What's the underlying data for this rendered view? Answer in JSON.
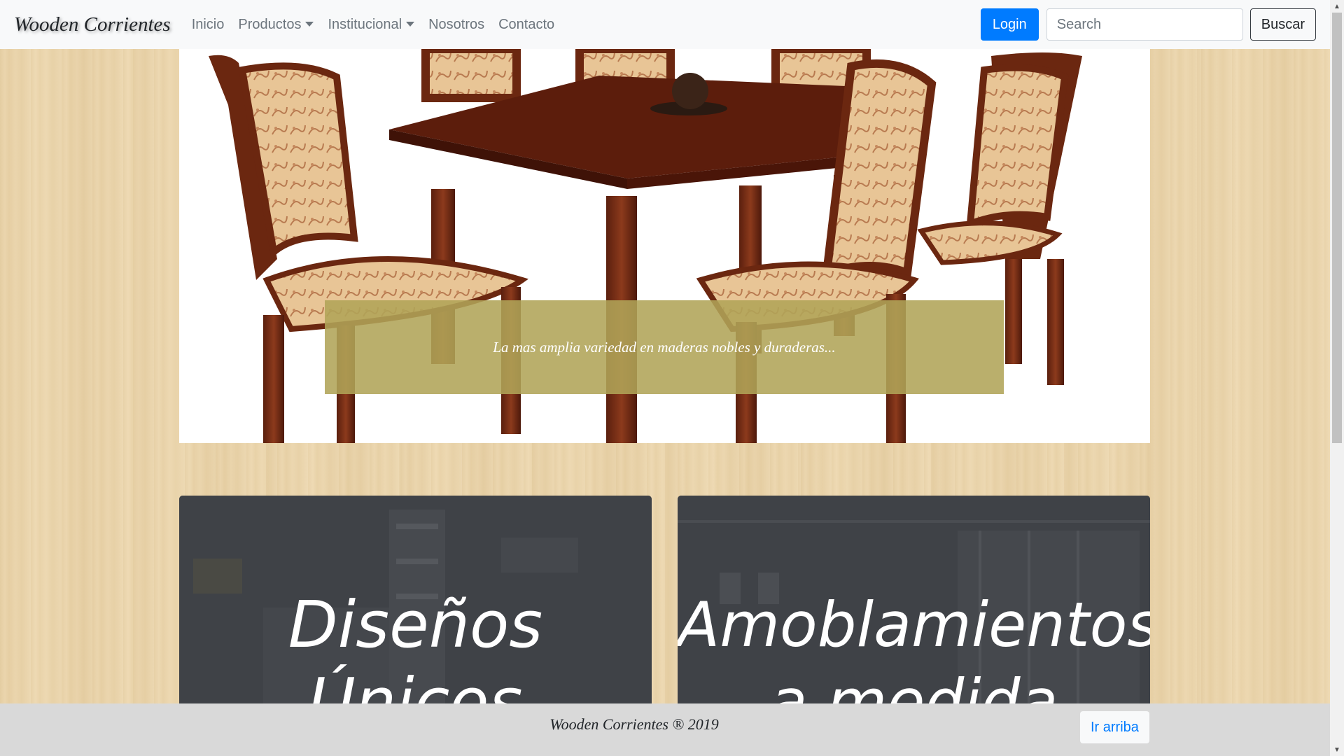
{
  "navbar": {
    "brand": "Wooden Corrientes",
    "items": [
      {
        "label": "Inicio",
        "dropdown": false
      },
      {
        "label": "Productos",
        "dropdown": true
      },
      {
        "label": "Institucional",
        "dropdown": true
      },
      {
        "label": "Nosotros",
        "dropdown": false
      },
      {
        "label": "Contacto",
        "dropdown": false
      }
    ],
    "login_label": "Login",
    "search_placeholder": "Search",
    "search_value": "",
    "search_button_label": "Buscar"
  },
  "hero": {
    "caption": "La mas amplia variedad en maderas nobles y duraderas..."
  },
  "cards": [
    {
      "title": "Diseños Únicos"
    },
    {
      "title": "Amoblamientos a medida"
    }
  ],
  "footer": {
    "text": "Wooden Corrientes ® 2019",
    "top_button_label": "Ir arriba"
  },
  "colors": {
    "primary": "#007bff",
    "navbar_bg": "#f8f9fa",
    "caption_bg": "#b0a458",
    "card_bg": "#3f4247",
    "footer_bg": "#d9d9d9"
  }
}
